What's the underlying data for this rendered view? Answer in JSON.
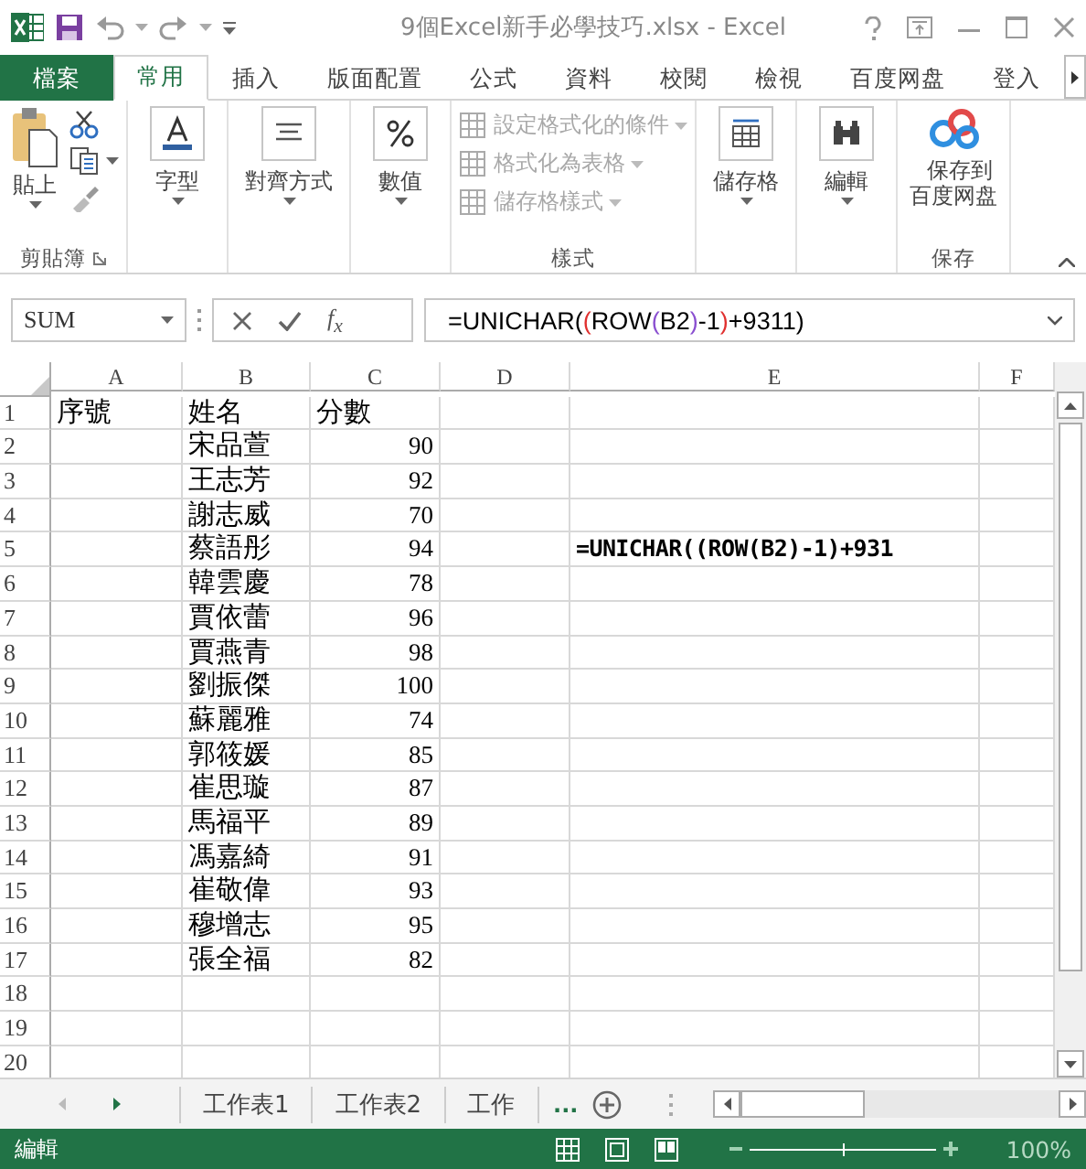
{
  "window": {
    "title": "9個Excel新手必學技巧.xlsx - Excel"
  },
  "ribbon_tabs": [
    {
      "label": "檔案",
      "kind": "file",
      "selected": false
    },
    {
      "label": "常用",
      "kind": "tab",
      "selected": true
    },
    {
      "label": "插入",
      "kind": "tab",
      "selected": false
    },
    {
      "label": "版面配置",
      "kind": "tab",
      "selected": false
    },
    {
      "label": "公式",
      "kind": "tab",
      "selected": false
    },
    {
      "label": "資料",
      "kind": "tab",
      "selected": false
    },
    {
      "label": "校閱",
      "kind": "tab",
      "selected": false
    },
    {
      "label": "檢視",
      "kind": "tab",
      "selected": false
    },
    {
      "label": "百度网盘",
      "kind": "tab",
      "selected": false
    },
    {
      "label": "登入",
      "kind": "tab",
      "selected": false
    }
  ],
  "ribbon_groups": [
    {
      "label": "剪貼簿",
      "kind": "clipboard",
      "items": [
        {
          "label": "貼上"
        }
      ]
    },
    {
      "kind": "font",
      "items": [
        {
          "label": "字型"
        }
      ]
    },
    {
      "kind": "alignment",
      "items": [
        {
          "label": "對齊方式"
        }
      ]
    },
    {
      "kind": "number",
      "items": [
        {
          "label": "數值"
        }
      ]
    },
    {
      "label": "樣式",
      "kind": "styles",
      "items": [
        {
          "label": "設定格式化的條件",
          "disabled": true
        },
        {
          "label": "格式化為表格",
          "disabled": true
        },
        {
          "label": "儲存格樣式",
          "disabled": true
        }
      ]
    },
    {
      "kind": "cells",
      "items": [
        {
          "label": "儲存格"
        }
      ]
    },
    {
      "kind": "editing",
      "items": [
        {
          "label": "編輯"
        }
      ]
    },
    {
      "label": "保存",
      "kind": "cloud",
      "items": [
        {
          "label": "保存到百度网盘"
        }
      ]
    }
  ],
  "formula_bar": {
    "name_box": "SUM",
    "fx": "f$_{x}$",
    "segments": [
      {
        "text": "=UNICHAR(",
        "color": "#000000"
      },
      {
        "text": "(",
        "color": "#e0302f"
      },
      {
        "text": "ROW",
        "color": "#000000"
      },
      {
        "text": "(",
        "color": "#8a4fd0"
      },
      {
        "text": "B2",
        "color": "#000000"
      },
      {
        "text": ")",
        "color": "#8a4fd0"
      },
      {
        "text": "-1",
        "color": "#000000"
      },
      {
        "text": ")",
        "color": "#e0302f"
      },
      {
        "text": "+9311)",
        "color": "#000000"
      }
    ]
  },
  "columns": [
    "A",
    "B",
    "C",
    "D",
    "E",
    "F"
  ],
  "rows": [
    {
      "header": "1",
      "a": "序號",
      "b": "姓名",
      "c": "分數"
    },
    {
      "header": "2",
      "b": "宋品萱",
      "c": "90"
    },
    {
      "header": "3",
      "b": "王志芳",
      "c": "92"
    },
    {
      "header": "4",
      "b": "謝志威",
      "c": "70"
    },
    {
      "header": "5",
      "b": "蔡語彤",
      "c": "94",
      "e": "=UNICHAR((ROW(B2)-1)+931"
    },
    {
      "header": "6",
      "b": "韓雲慶",
      "c": "78"
    },
    {
      "header": "7",
      "b": "賈依蕾",
      "c": "96"
    },
    {
      "header": "8",
      "b": "賈燕青",
      "c": "98"
    },
    {
      "header": "9",
      "b": "劉振傑",
      "c": "100"
    },
    {
      "header": "10",
      "b": "蘇麗雅",
      "c": "74"
    },
    {
      "header": "11",
      "b": "郭筱媛",
      "c": "85"
    },
    {
      "header": "12",
      "b": "崔思璇",
      "c": "87"
    },
    {
      "header": "13",
      "b": "馬福平",
      "c": "89"
    },
    {
      "header": "14",
      "b": "馮嘉綺",
      "c": "91"
    },
    {
      "header": "15",
      "b": "崔敬偉",
      "c": "93"
    },
    {
      "header": "16",
      "b": "穆增志",
      "c": "95"
    },
    {
      "header": "17",
      "b": "張全福",
      "c": "82"
    },
    {
      "header": "18"
    },
    {
      "header": "19"
    },
    {
      "header": "20"
    }
  ],
  "sheet_tabs": [
    {
      "label": "工作表1"
    },
    {
      "label": "工作表2"
    },
    {
      "label": "工作"
    }
  ],
  "sheet_overflow": "...",
  "status_bar": {
    "mode": "編輯",
    "zoom": {
      "level": 0.5
    },
    "zoom_text": "100%"
  }
}
